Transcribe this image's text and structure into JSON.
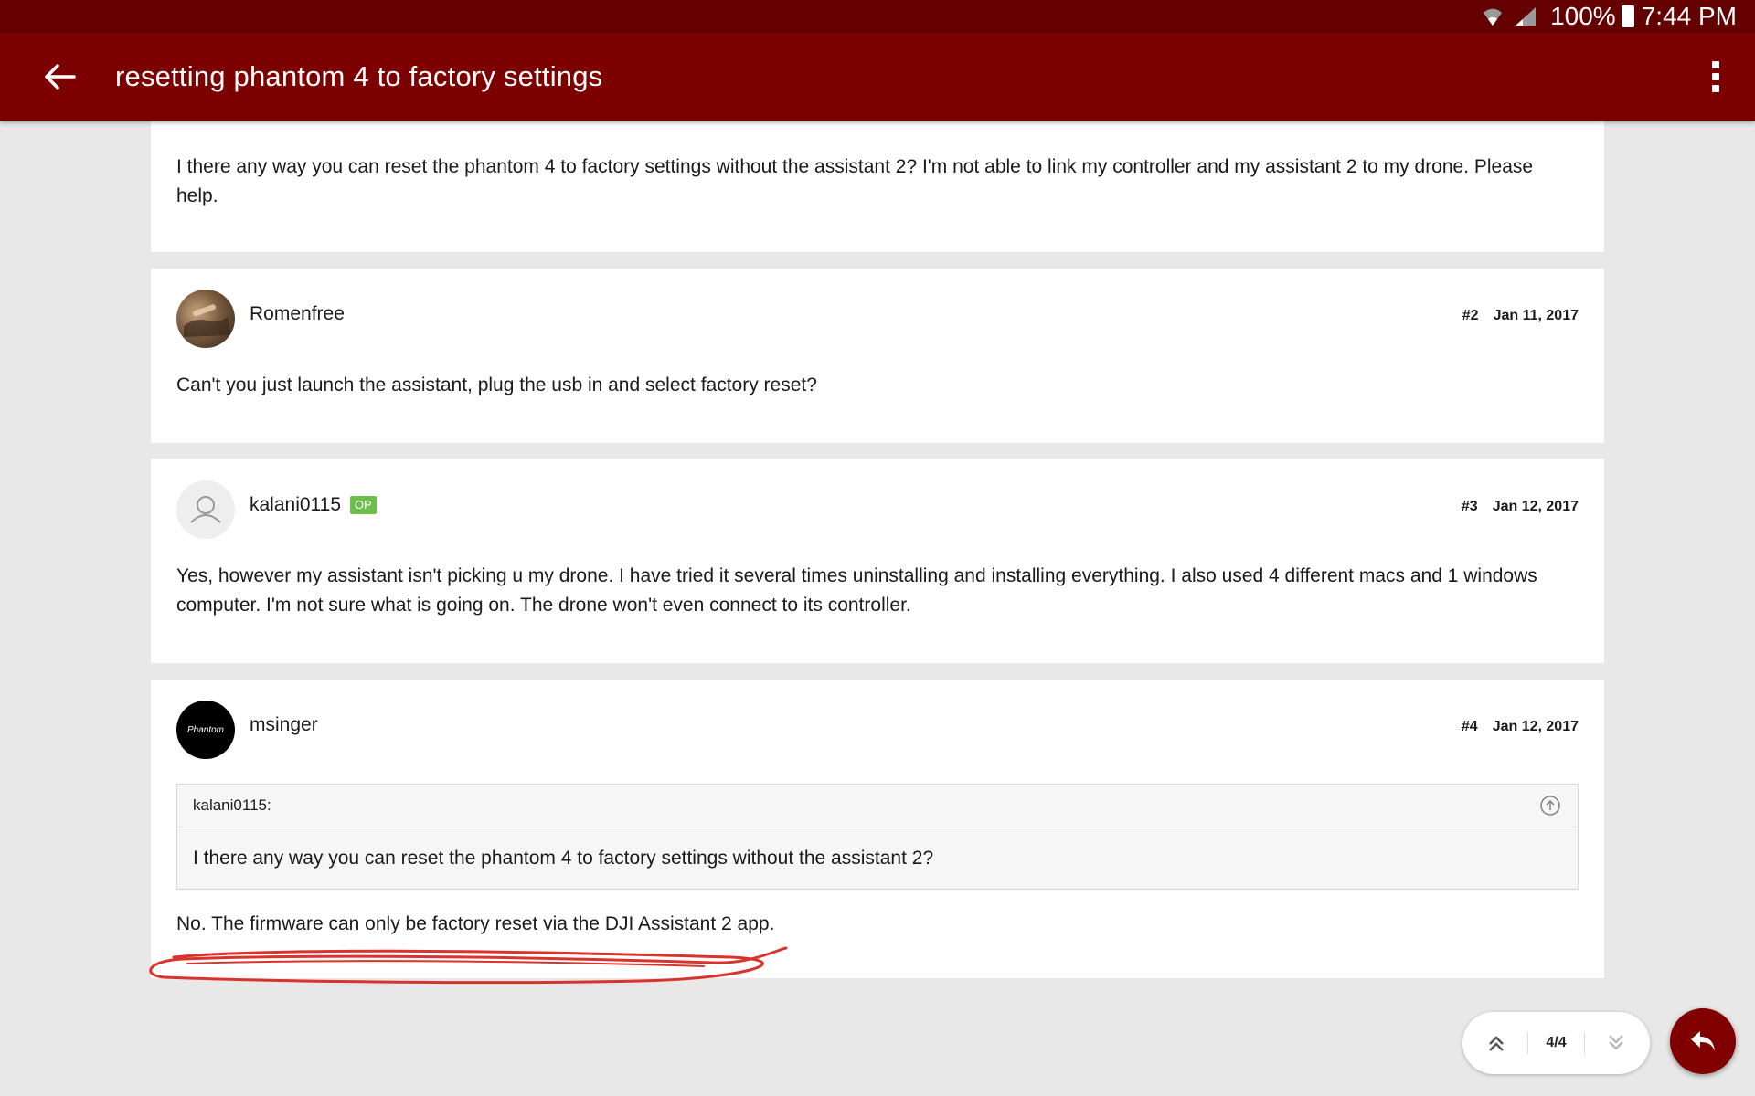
{
  "status_bar": {
    "battery": "100%",
    "time": "7:44 PM"
  },
  "app_bar": {
    "title": "resetting phantom 4 to factory settings"
  },
  "posts": [
    {
      "body": "I there any way you can reset the phantom 4 to factory settings without the assistant 2? I'm not able to link my controller and my assistant 2 to my drone. Please help."
    },
    {
      "username": "Romenfree",
      "number": "#2",
      "date": "Jan 11, 2017",
      "body": "Can't you just launch the assistant, plug the usb in and select factory reset?"
    },
    {
      "username": "kalani0115",
      "badge": "OP",
      "number": "#3",
      "date": "Jan 12, 2017",
      "body": "Yes, however my assistant isn't picking u my drone. I have tried it several times uninstalling and installing everything. I also used 4 different macs and 1 windows computer. I'm not sure what is going on. The drone won't even connect to its controller."
    },
    {
      "username": "msinger",
      "avatar_text": "Phantom",
      "number": "#4",
      "date": "Jan 12, 2017",
      "quote": {
        "author": "kalani0115:",
        "text": "I there any way you can reset the phantom 4 to factory settings without the assistant 2?"
      },
      "body": "No. The firmware can only be factory reset via the DJI Assistant 2 app."
    }
  ],
  "pagination": {
    "label": "4/4"
  },
  "colors": {
    "app_bar": "#7d0000",
    "status_bar": "#650000",
    "op_badge": "#6cc04a",
    "fab": "#800000",
    "annotation": "#d9342b"
  },
  "icons": [
    "wifi-icon",
    "signal-icon",
    "battery-icon",
    "back-arrow-icon",
    "more-vert-icon",
    "user-placeholder-icon",
    "quote-up-icon",
    "chevron-double-up-icon",
    "chevron-double-down-icon",
    "reply-icon"
  ]
}
